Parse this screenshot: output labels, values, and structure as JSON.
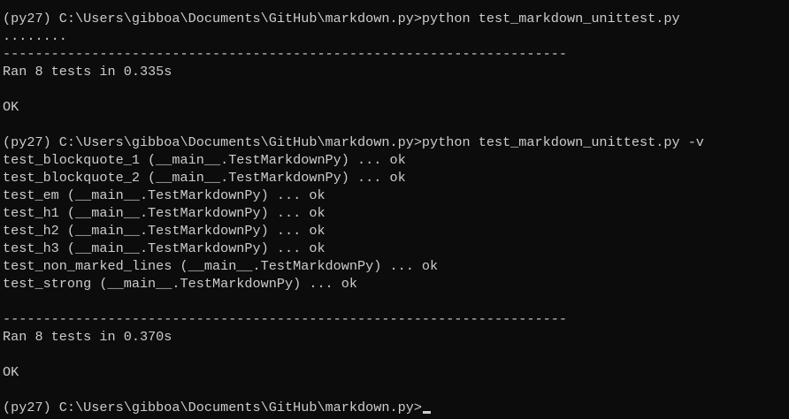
{
  "console": {
    "lines": [
      "(py27) C:\\Users\\gibboa\\Documents\\GitHub\\markdown.py>python test_markdown_unittest.py",
      "........",
      "----------------------------------------------------------------------",
      "Ran 8 tests in 0.335s",
      "",
      "OK",
      "",
      "(py27) C:\\Users\\gibboa\\Documents\\GitHub\\markdown.py>python test_markdown_unittest.py -v",
      "test_blockquote_1 (__main__.TestMarkdownPy) ... ok",
      "test_blockquote_2 (__main__.TestMarkdownPy) ... ok",
      "test_em (__main__.TestMarkdownPy) ... ok",
      "test_h1 (__main__.TestMarkdownPy) ... ok",
      "test_h2 (__main__.TestMarkdownPy) ... ok",
      "test_h3 (__main__.TestMarkdownPy) ... ok",
      "test_non_marked_lines (__main__.TestMarkdownPy) ... ok",
      "test_strong (__main__.TestMarkdownPy) ... ok",
      "",
      "----------------------------------------------------------------------",
      "Ran 8 tests in 0.370s",
      "",
      "OK",
      "",
      "(py27) C:\\Users\\gibboa\\Documents\\GitHub\\markdown.py>"
    ]
  },
  "colors": {
    "background": "#0c0c0c",
    "foreground": "#cccccc"
  }
}
